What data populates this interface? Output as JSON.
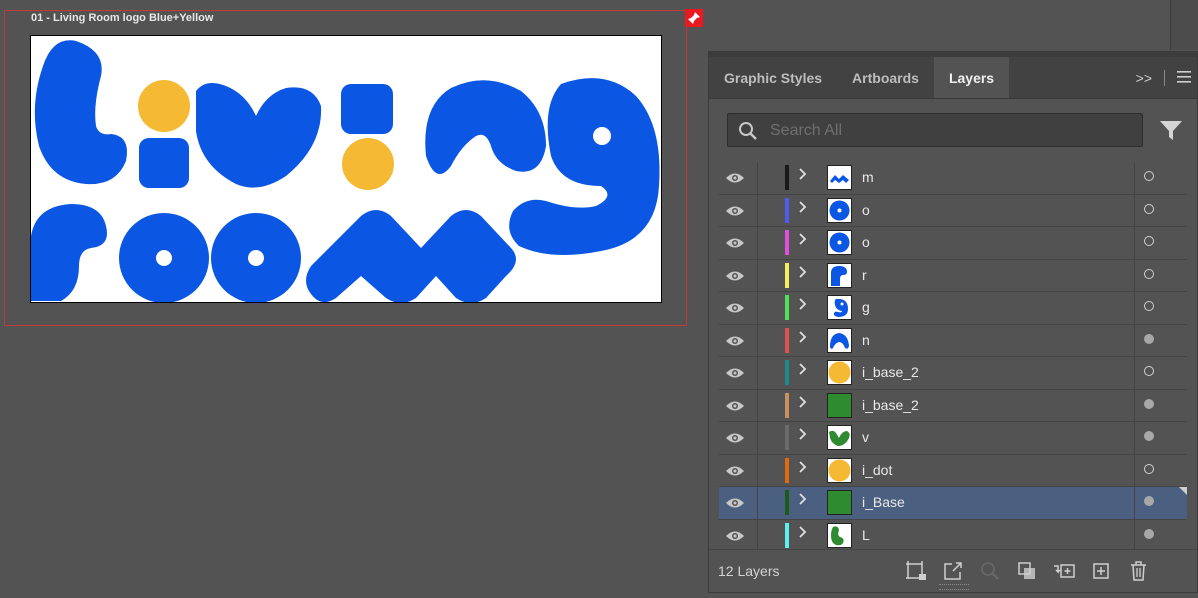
{
  "artboard": {
    "label": "01 - Living Room logo Blue+Yellow"
  },
  "colors": {
    "logo_blue": "#0b57e3",
    "logo_yellow": "#f5b934",
    "accent_green": "#2e8b30"
  },
  "panel": {
    "tabs": [
      {
        "label": "Graphic Styles",
        "active": false
      },
      {
        "label": "Artboards",
        "active": false
      },
      {
        "label": "Layers",
        "active": true
      }
    ],
    "overflow_label": ">>",
    "search": {
      "placeholder": "Search All"
    },
    "layers": [
      {
        "name": "m",
        "color": "#1a1a1a",
        "thumb": "m-blue",
        "target_filled": false,
        "selected": false
      },
      {
        "name": "o",
        "color": "#4f5bf0",
        "thumb": "o-blue",
        "target_filled": false,
        "selected": false
      },
      {
        "name": "o",
        "color": "#e04fe0",
        "thumb": "o-blue",
        "target_filled": false,
        "selected": false
      },
      {
        "name": "r",
        "color": "#f4f05a",
        "thumb": "r-blue",
        "target_filled": false,
        "selected": false
      },
      {
        "name": "g",
        "color": "#4fe05a",
        "thumb": "g-blue",
        "target_filled": false,
        "selected": false
      },
      {
        "name": "n",
        "color": "#e05050",
        "thumb": "n-blue",
        "target_filled": true,
        "selected": false
      },
      {
        "name": "i_base_2",
        "color": "#1a8a8a",
        "thumb": "yellow-circle",
        "target_filled": false,
        "selected": false
      },
      {
        "name": "i_base_2",
        "color": "#c89060",
        "thumb": "green-square",
        "target_filled": true,
        "selected": false
      },
      {
        "name": "v",
        "color": "#6a6a6a",
        "thumb": "v-green",
        "target_filled": true,
        "selected": false
      },
      {
        "name": "i_dot",
        "color": "#e06a10",
        "thumb": "yellow-circle",
        "target_filled": false,
        "selected": false
      },
      {
        "name": "i_Base",
        "color": "#1a5a1a",
        "thumb": "green-square",
        "target_filled": true,
        "selected": true
      },
      {
        "name": "L",
        "color": "#5af0f0",
        "thumb": "l-green",
        "target_filled": true,
        "selected": false
      }
    ],
    "footer": {
      "layer_count": "12 Layers"
    }
  }
}
